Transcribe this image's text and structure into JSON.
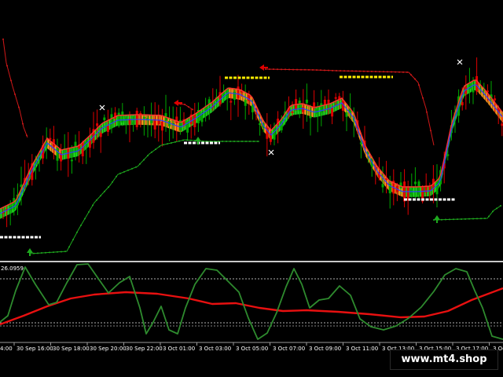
{
  "indicator": {
    "value_label": "26.0959"
  },
  "time_axis": {
    "labels": [
      "4:00",
      "30 Sep 16:00",
      "30 Sep 18:00",
      "30 Sep 20:00",
      "30 Sep 22:00",
      "3 Oct 01:00",
      "3 Oct 03:00",
      "3 Oct 05:00",
      "3 Oct 07:00",
      "3 Oct 09:00",
      "3 Oct 11:00",
      "3 Oct 13:00",
      "3 Oct 15:00",
      "3 Oct 17:00",
      "3 Oc"
    ]
  },
  "watermark": {
    "text": "www.mt4.shop"
  },
  "colors": {
    "background": "#000000",
    "candle_up": "#00a800",
    "candle_down": "#e00000",
    "ribbon_up": "#22dd22",
    "ribbon_down": "#ff9a20",
    "ribbon_center": "#2a3cff",
    "ribbon_line": "#ff3030",
    "trail_up": "#1ea81e",
    "trail_down": "#d01818",
    "level_white": "#ffffff",
    "level_yellow": "#ffee00",
    "osc_green": "#2e8b2e",
    "osc_red": "#e81010",
    "separator": "#c8c8c8"
  },
  "icons": [
    "arrow-up-icon",
    "arrow-left-icon",
    "cross-marker-icon"
  ]
}
